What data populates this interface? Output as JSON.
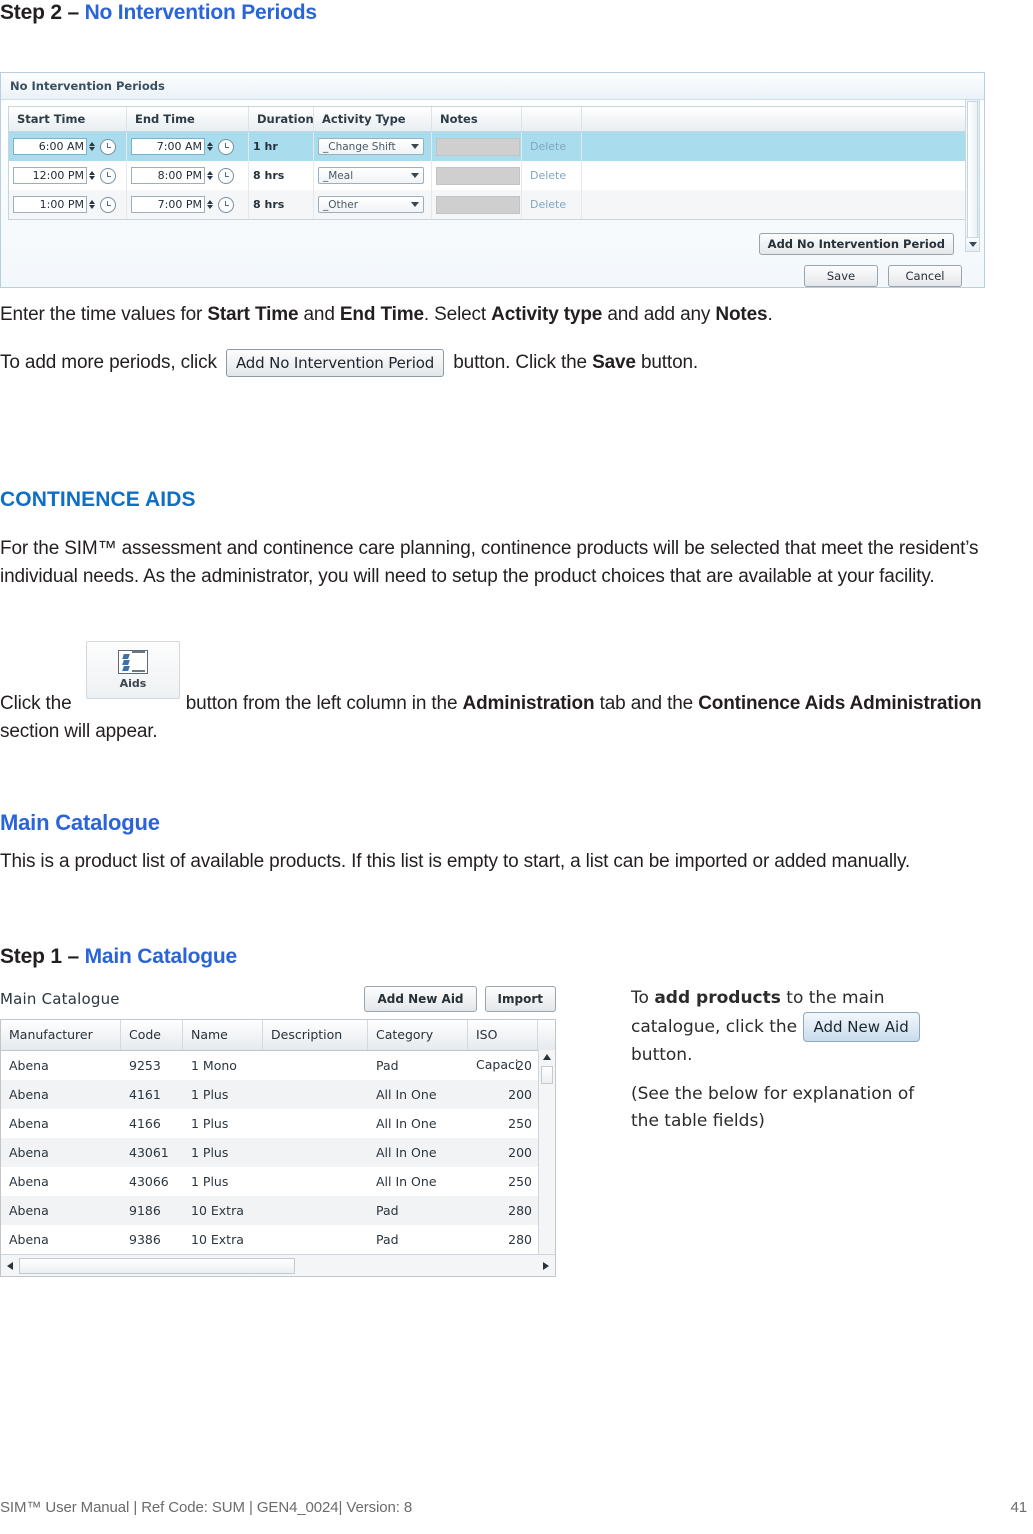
{
  "document": {
    "step2_heading_prefix": "Step 2 – ",
    "step2_heading_link": "No Intervention Periods",
    "para_enter_1": "Enter the time values for ",
    "para_enter_b1": "Start Time",
    "para_enter_2": " and ",
    "para_enter_b2": "End Time",
    "para_enter_3": ".  Select ",
    "para_enter_b3": "Activity type",
    "para_enter_4": " and add any ",
    "para_enter_b4": "Notes",
    "para_enter_5": ".",
    "para_add_1": "To add more periods, click ",
    "para_add_btn": "Add No Intervention Period",
    "para_add_2": " button.  Click the ",
    "para_add_b": "Save",
    "para_add_3": " button.",
    "section_heading": "CONTINENCE AIDS",
    "para_sim": "For the SIM™ assessment and continence care planning, continence products will be selected that meet the resident’s individual needs. As the administrator, you will need to setup the product choices that are available at your facility.",
    "para_click_1": "Click the ",
    "para_click_2": " button from the left column in the ",
    "para_click_b1": "Administration",
    "para_click_3": " tab and the ",
    "para_click_b2": "Continence Aids Administration",
    "para_click_4": " section will appear.",
    "subheading_main_catalogue": "Main Catalogue",
    "para_catalogue": "This is a product list of available products. If this list is empty to start, a list can be imported or added manually.",
    "step1_heading_prefix": "Step 1 – ",
    "step1_heading_link": "Main Catalogue"
  },
  "aids_button": {
    "label": "Aids",
    "icon": "list-clipboard-icon"
  },
  "screenshot_nip": {
    "title": "No Intervention Periods",
    "columns": [
      "Start Time",
      "End Time",
      "Duration",
      "Activity Type",
      "Notes",
      "",
      ""
    ],
    "rows": [
      {
        "start": "6:00 AM",
        "end": "7:00 AM",
        "duration": "1 hr",
        "activity": "_Change Shift",
        "notes": "",
        "delete": "Delete",
        "selected": true
      },
      {
        "start": "12:00 PM",
        "end": "8:00 PM",
        "duration": "8 hrs",
        "activity": "_Meal",
        "notes": "",
        "delete": "Delete",
        "selected": false
      },
      {
        "start": "1:00 PM",
        "end": "7:00 PM",
        "duration": "8 hrs",
        "activity": "_Other",
        "notes": "",
        "delete": "Delete",
        "selected": false
      }
    ],
    "add_button": "Add No Intervention Period",
    "save_button": "Save",
    "cancel_button": "Cancel",
    "selected_row_color": "#a9dcec"
  },
  "screenshot_catalogue": {
    "title": "Main Catalogue",
    "add_new_aid_button": "Add New Aid",
    "import_button": "Import",
    "columns": [
      "Manufacturer",
      "Code",
      "Name",
      "Description",
      "Category",
      "ISO Capaci"
    ],
    "rows": [
      {
        "manufacturer": "Abena",
        "code": "9253",
        "name": "1 Mono",
        "description": "",
        "category": "Pad",
        "iso": "20"
      },
      {
        "manufacturer": "Abena",
        "code": "4161",
        "name": "1 Plus",
        "description": "",
        "category": "All In One",
        "iso": "200"
      },
      {
        "manufacturer": "Abena",
        "code": "4166",
        "name": "1 Plus",
        "description": "",
        "category": "All In One",
        "iso": "250"
      },
      {
        "manufacturer": "Abena",
        "code": "43061",
        "name": "1 Plus",
        "description": "",
        "category": "All In One",
        "iso": "200"
      },
      {
        "manufacturer": "Abena",
        "code": "43066",
        "name": "1 Plus",
        "description": "",
        "category": "All In One",
        "iso": "250"
      },
      {
        "manufacturer": "Abena",
        "code": "9186",
        "name": "10 Extra",
        "description": "",
        "category": "Pad",
        "iso": "280"
      },
      {
        "manufacturer": "Abena",
        "code": "9386",
        "name": "10 Extra",
        "description": "",
        "category": "Pad",
        "iso": "280"
      }
    ]
  },
  "right_column": {
    "line1_a": "To ",
    "line1_b": "add products",
    "line1_c": " to the main catalogue, click the ",
    "button_label": "Add New Aid",
    "line1_d": "button.",
    "line2": "(See the below for explanation of the table fields)"
  },
  "footer": {
    "text": "SIM™ User Manual | Ref Code: SUM | GEN4_0024| Version: 8",
    "page": "41"
  },
  "colors": {
    "heading_blue": "#2b64d9",
    "section_blue": "#0f6fc6",
    "body_text": "#231f20",
    "footer_gray": "#6b6b6b"
  }
}
